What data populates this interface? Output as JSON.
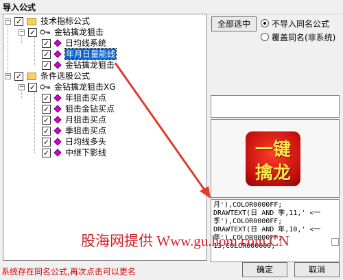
{
  "window": {
    "title": "导入公式"
  },
  "tree": {
    "root1": {
      "label": "技术指标公式",
      "checked": true
    },
    "group1": {
      "label": "金钻擒龙狙击",
      "checked": true
    },
    "group1_items": [
      {
        "label": "日均线系统",
        "checked": true,
        "selected": false
      },
      {
        "label": "年月日量能线",
        "checked": true,
        "selected": true
      },
      {
        "label": "金钻擒龙狙击",
        "checked": true,
        "selected": false
      }
    ],
    "root2": {
      "label": "条件选股公式",
      "checked": true
    },
    "group2": {
      "label": "金钻擒龙狙击XG",
      "checked": true
    },
    "group2_items": [
      {
        "label": "年狙击买点",
        "checked": true
      },
      {
        "label": "狙击金钻买点",
        "checked": true
      },
      {
        "label": "月狙击买点",
        "checked": true
      },
      {
        "label": "季狙击买点",
        "checked": true
      },
      {
        "label": "日均线多头",
        "checked": true
      },
      {
        "label": "中继下影线",
        "checked": true
      }
    ]
  },
  "options": {
    "select_all_label": "全部选中",
    "radio_no_import": "不导入同名公式",
    "radio_overwrite": "覆盖同名(非系统)",
    "selected": "radio_no_import"
  },
  "logo": {
    "line1": "一键",
    "line2": "擒龙"
  },
  "code_lines": [
    "月'),COLOR0000FF;",
    "DRAWTEXT(日 AND 季,11,' <一",
    "季'),COLOR0000FF;",
    "DRAWTEXT(日 AND 年,10,' <一",
    "年'),COLOR0000FF;",
    "13,COLOR000000;"
  ],
  "watermark": "股海网提供 Www.gu.hom.com.CN",
  "status": "系统存在同名公式,再次点击可以更名",
  "buttons": {
    "ok": "确定",
    "cancel": "取消"
  },
  "colors": {
    "selection": "#0a64d0",
    "status": "#d00000",
    "watermark": "#d2222a",
    "arrow": "#e03a2a"
  }
}
